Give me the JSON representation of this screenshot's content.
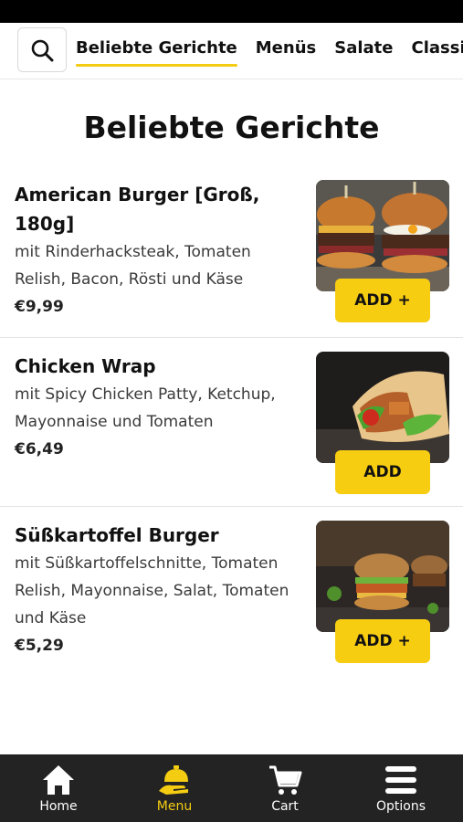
{
  "categories": {
    "search_icon": "search-icon",
    "tabs": [
      {
        "label": "Beliebte Gerichte",
        "active": true
      },
      {
        "label": "Menüs",
        "active": false
      },
      {
        "label": "Salate",
        "active": false
      },
      {
        "label": "Classics",
        "active": false
      }
    ]
  },
  "section": {
    "title": "Beliebte Gerichte"
  },
  "items": [
    {
      "name": "American Burger [Groß, 180g]",
      "description": "mit Rinderhacksteak, Tomaten Relish, Bacon, Rösti und Käse",
      "price": "€9,99",
      "add_label": "ADD +"
    },
    {
      "name": "Chicken Wrap",
      "description": "mit Spicy Chicken Patty, Ketchup, Mayonnaise und Tomaten",
      "price": "€6,49",
      "add_label": "ADD"
    },
    {
      "name": "Süßkartoffel Burger",
      "description": "mit Süßkartoffelschnitte, Tomaten Relish, Mayonnaise, Salat, Tomaten und Käse",
      "price": "€5,29",
      "add_label": "ADD +"
    }
  ],
  "nav": [
    {
      "label": "Home",
      "icon": "home-icon",
      "active": false
    },
    {
      "label": "Menu",
      "icon": "waiter-bell-icon",
      "active": true
    },
    {
      "label": "Cart",
      "icon": "cart-icon",
      "active": false
    },
    {
      "label": "Options",
      "icon": "menu-bars-icon",
      "active": false
    }
  ],
  "colors": {
    "accent": "#f7cd12",
    "nav_bg": "#232323"
  }
}
